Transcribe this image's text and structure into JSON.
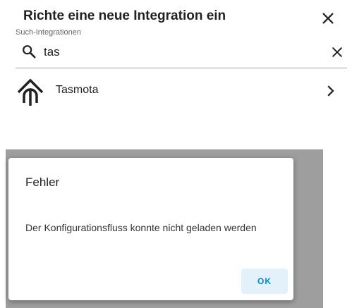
{
  "dialog": {
    "title": "Richte eine neue Integration ein",
    "close_icon": "close-icon"
  },
  "search": {
    "label": "Such-Integrationen",
    "value": "tas",
    "search_icon": "search-icon",
    "clear_icon": "close-icon"
  },
  "integrations": [
    {
      "name": "Tasmota",
      "logo_icon": "tasmota-logo-icon",
      "chevron_icon": "chevron-right-icon"
    }
  ],
  "error_dialog": {
    "title": "Fehler",
    "message": "Der Konfigurationsfluss konnte nicht geladen werden",
    "ok_label": "OK"
  },
  "colors": {
    "accent": "#0288d1",
    "button_bg": "#e3f1fb",
    "scrim": "#9e9e9e",
    "text": "#212121"
  }
}
